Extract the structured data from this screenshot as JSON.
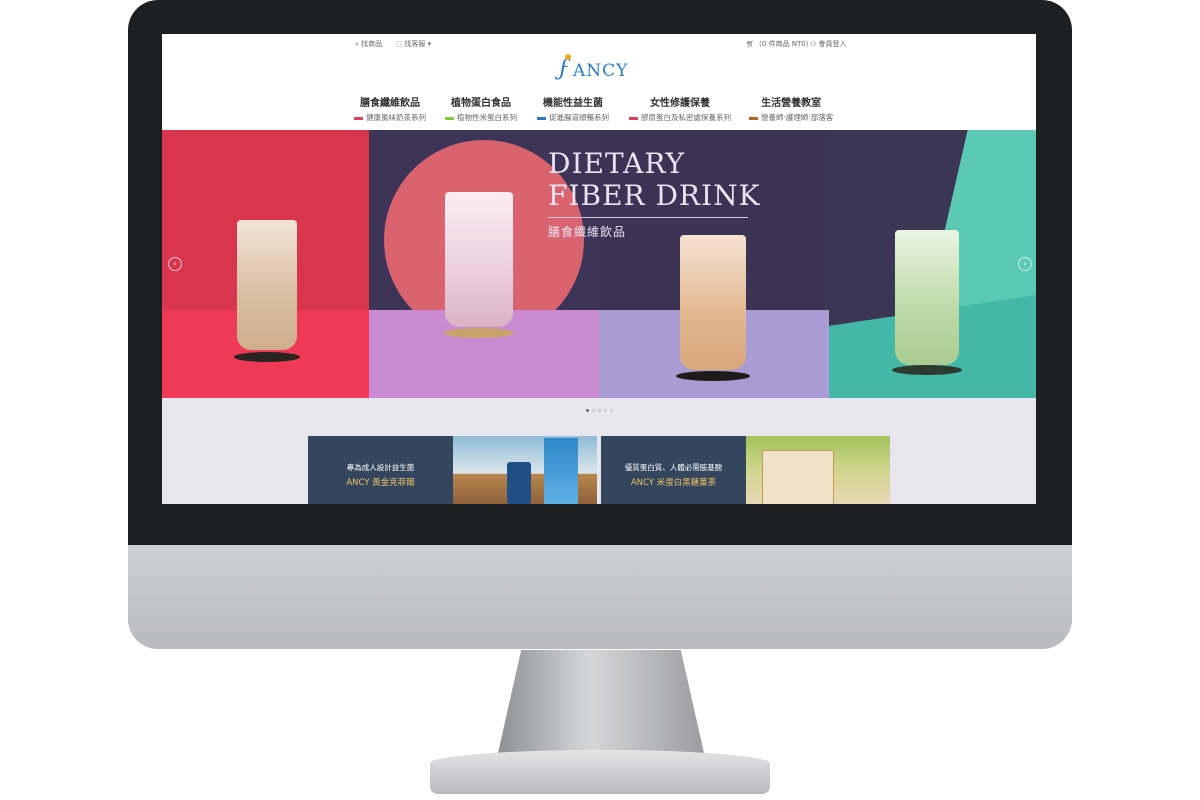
{
  "topbar": {
    "search": "找商品",
    "contact": "找客服",
    "cart": "（0 件商品 NT0）",
    "login": "會員登入"
  },
  "logo": {
    "text": "ANCY"
  },
  "nav": [
    {
      "title": "膳食纖維飲品",
      "sub": "健康風味奶茶系列",
      "color": "#e0415a"
    },
    {
      "title": "植物蛋白食品",
      "sub": "植物性米蛋白系列",
      "color": "#8cc63f"
    },
    {
      "title": "機能性益生菌",
      "sub": "促進腸道順暢系列",
      "color": "#2a7ac2"
    },
    {
      "title": "女性修護保養",
      "sub": "膠原蛋白及私密處保養系列",
      "color": "#e0415a"
    },
    {
      "title": "生活營養教室",
      "sub": "營養師‧護理師‧部落客",
      "color": "#b5651d"
    }
  ],
  "hero": {
    "title_line1": "DIETARY",
    "title_line2": "FIBER DRINK",
    "subtitle": "膳食纖維飲品",
    "slides": 5,
    "active_slide": 1
  },
  "cards": [
    {
      "line1": "專為成人設計益生菌",
      "line2": "ANCY 黃金克菲爾"
    },
    {
      "line1": "優質蛋白質、人體必需胺基酸",
      "line2": "ANCY 米蛋白黑糖薑茶"
    }
  ]
}
